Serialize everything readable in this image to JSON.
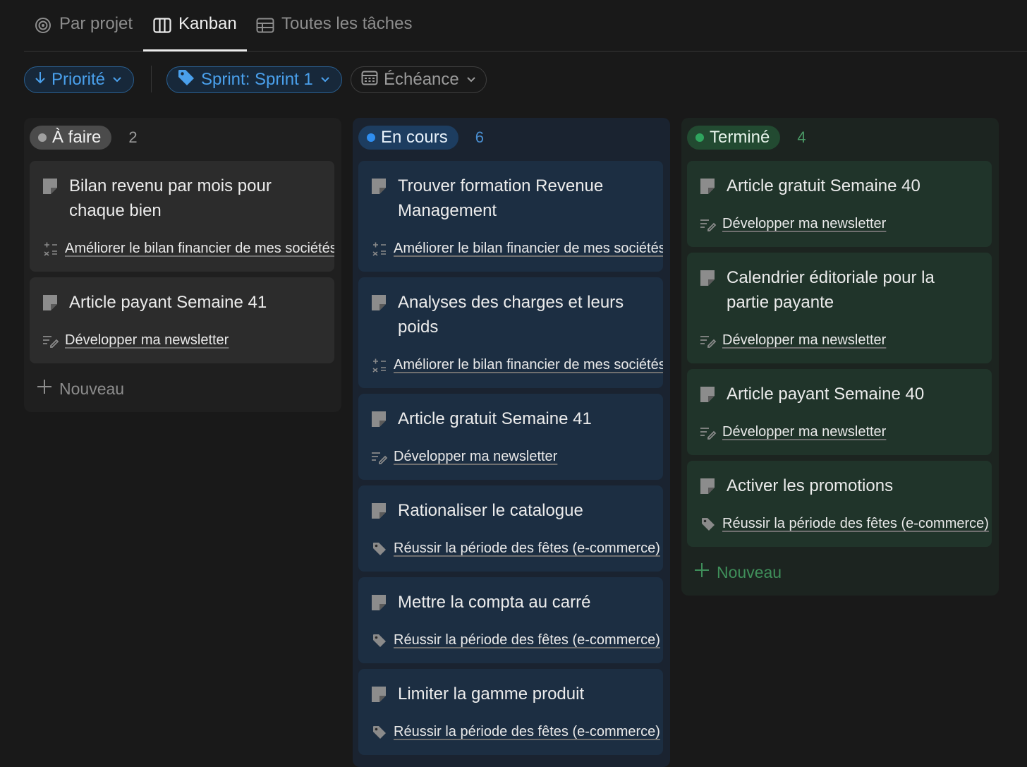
{
  "tabs": [
    {
      "label": "Par projet",
      "icon": "target-icon"
    },
    {
      "label": "Kanban",
      "icon": "board-icon"
    },
    {
      "label": "Toutes les tâches",
      "icon": "table-icon"
    }
  ],
  "active_tab": "Kanban",
  "filters": {
    "priority": {
      "label": "Priorité",
      "icon": "arrow-down-icon"
    },
    "sprint": {
      "label": "Sprint: Sprint 1",
      "icon": "tag-icon"
    },
    "due": {
      "label": "Échéance",
      "icon": "calendar-icon"
    }
  },
  "colors": {
    "accent_blue": "#4aa0ec",
    "status_todo": "#a0a0a0",
    "status_doing": "#2f8ef0",
    "status_done": "#2fa55e"
  },
  "columns": {
    "todo": {
      "label": "À faire",
      "count": "2",
      "new_label": "Nouveau",
      "cards": [
        {
          "title": "Bilan revenu par mois pour chaque bien",
          "relation": "Améliorer le bilan financier de mes sociétés",
          "relation_icon": "calculator-icon"
        },
        {
          "title": "Article payant Semaine 41",
          "relation": "Développer ma newsletter",
          "relation_icon": "edit-lines-icon"
        }
      ]
    },
    "doing": {
      "label": "En cours",
      "count": "6",
      "cards": [
        {
          "title": "Trouver formation Revenue Management",
          "relation": "Améliorer le bilan financier de mes sociétés",
          "relation_icon": "calculator-icon"
        },
        {
          "title": "Analyses des charges et leurs poids",
          "relation": "Améliorer le bilan financier de mes sociétés",
          "relation_icon": "calculator-icon"
        },
        {
          "title": "Article gratuit Semaine 41",
          "relation": "Développer ma newsletter",
          "relation_icon": "edit-lines-icon"
        },
        {
          "title": "Rationaliser le catalogue",
          "relation": "Réussir la période des fêtes (e-commerce)",
          "relation_icon": "tag-icon"
        },
        {
          "title": "Mettre la compta au carré",
          "relation": "Réussir la période des fêtes (e-commerce)",
          "relation_icon": "tag-icon"
        },
        {
          "title": "Limiter la gamme produit",
          "relation": "Réussir la période des fêtes (e-commerce)",
          "relation_icon": "tag-icon"
        }
      ]
    },
    "done": {
      "label": "Terminé",
      "count": "4",
      "new_label": "Nouveau",
      "cards": [
        {
          "title": "Article gratuit Semaine 40",
          "relation": "Développer ma newsletter",
          "relation_icon": "edit-lines-icon"
        },
        {
          "title": "Calendrier éditoriale pour la partie payante",
          "relation": "Développer ma newsletter",
          "relation_icon": "edit-lines-icon"
        },
        {
          "title": "Article payant Semaine 40",
          "relation": "Développer ma newsletter",
          "relation_icon": "edit-lines-icon"
        },
        {
          "title": "Activer les promotions",
          "relation": "Réussir la période des fêtes (e-commerce)",
          "relation_icon": "tag-icon"
        }
      ]
    }
  }
}
